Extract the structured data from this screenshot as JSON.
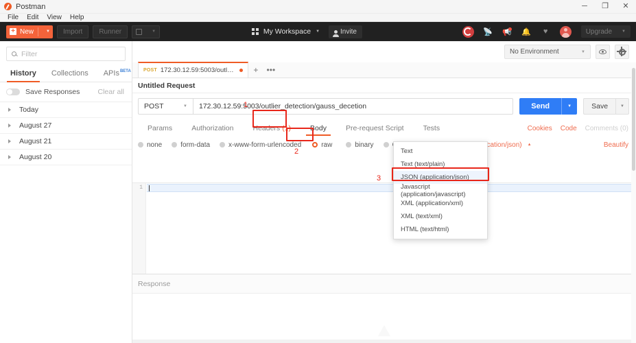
{
  "window": {
    "title": "Postman",
    "logo_icon": "postman-logo-icon",
    "minimize_label": "─",
    "maximize_label": "❐",
    "close_label": "✕"
  },
  "menubar": {
    "items": [
      "File",
      "Edit",
      "View",
      "Help"
    ]
  },
  "toolbar": {
    "new_label": "New",
    "new_plus": "+",
    "caret": "▼",
    "import_label": "Import",
    "runner_label": "Runner",
    "workspace_label": "My Workspace",
    "invite_label": "Invite",
    "upgrade_label": "Upgrade",
    "icons": {
      "sync": "sync-icon",
      "satellite": "satellite-icon",
      "megaphone": "announcement-icon",
      "bell": "notifications-icon",
      "heart": "favorites-icon",
      "avatar": "user-avatar-icon"
    }
  },
  "sidebar": {
    "filter": {
      "placeholder": "Filter",
      "value": ""
    },
    "tabs": [
      {
        "label": "History",
        "active": true,
        "beta": ""
      },
      {
        "label": "Collections",
        "active": false,
        "beta": ""
      },
      {
        "label": "APIs",
        "active": false,
        "beta": "BETA"
      }
    ],
    "save_responses_label": "Save Responses",
    "save_responses_on": false,
    "clear_all_label": "Clear all",
    "history_groups": [
      "Today",
      "August 27",
      "August 21",
      "August 20"
    ]
  },
  "environment": {
    "selected": "No Environment",
    "caret": "▼",
    "eye_icon": "eye-icon",
    "gear_icon": "gear-icon"
  },
  "request_tab": {
    "method": "POST",
    "url_short": "172.30.12.59:5003/outlier_det...",
    "unsaved": true,
    "new_tab_label": "+",
    "more_label": "•••"
  },
  "request": {
    "title": "Untitled Request",
    "method": "POST",
    "method_caret": "▼",
    "url": "172.30.12.59:5003/outlier_detection/gauss_decetion",
    "url_placeholder": "Enter request URL",
    "send_label": "Send",
    "send_caret": "▼",
    "save_label": "Save",
    "save_caret": "▼"
  },
  "request_tabs": [
    {
      "label": "Params",
      "active": false,
      "count": ""
    },
    {
      "label": "Authorization",
      "active": false,
      "count": ""
    },
    {
      "label": "Headers",
      "active": false,
      "count": "(1)"
    },
    {
      "label": "Body",
      "active": true,
      "count": ""
    },
    {
      "label": "Pre-request Script",
      "active": false,
      "count": ""
    },
    {
      "label": "Tests",
      "active": false,
      "count": ""
    }
  ],
  "request_tabs_right": [
    {
      "label": "Cookies",
      "dim": false
    },
    {
      "label": "Code",
      "dim": false
    },
    {
      "label": "Comments (0)",
      "dim": true
    }
  ],
  "body_types": [
    {
      "label": "none",
      "selected": false
    },
    {
      "label": "form-data",
      "selected": false
    },
    {
      "label": "x-www-form-urlencoded",
      "selected": false
    },
    {
      "label": "raw",
      "selected": true
    },
    {
      "label": "binary",
      "selected": false
    },
    {
      "label": "GraphQL",
      "selected": false,
      "beta": "BETA"
    }
  ],
  "body_format": {
    "selected": "JSON (application/json)",
    "caret": "▲",
    "beautify_label": "Beautify",
    "options": [
      "Text",
      "Text (text/plain)",
      "JSON (application/json)",
      "Javascript (application/javascript)",
      "XML (application/xml)",
      "XML (text/xml)",
      "HTML (text/html)"
    ],
    "highlighted_option": "JSON (application/json)"
  },
  "editor": {
    "line_numbers": [
      "1"
    ],
    "content": ""
  },
  "response": {
    "label": "Response"
  },
  "annotations": [
    {
      "number": "1",
      "target": "body-tab"
    },
    {
      "number": "2",
      "target": "raw-radio"
    },
    {
      "number": "3",
      "target": "json-option"
    }
  ],
  "colors": {
    "accent_orange": "#ef5b25",
    "send_blue": "#2f7df6",
    "annotation_red": "#e8261a",
    "toolbar_dark": "#212121",
    "link_orange": "#ef6c4e"
  }
}
